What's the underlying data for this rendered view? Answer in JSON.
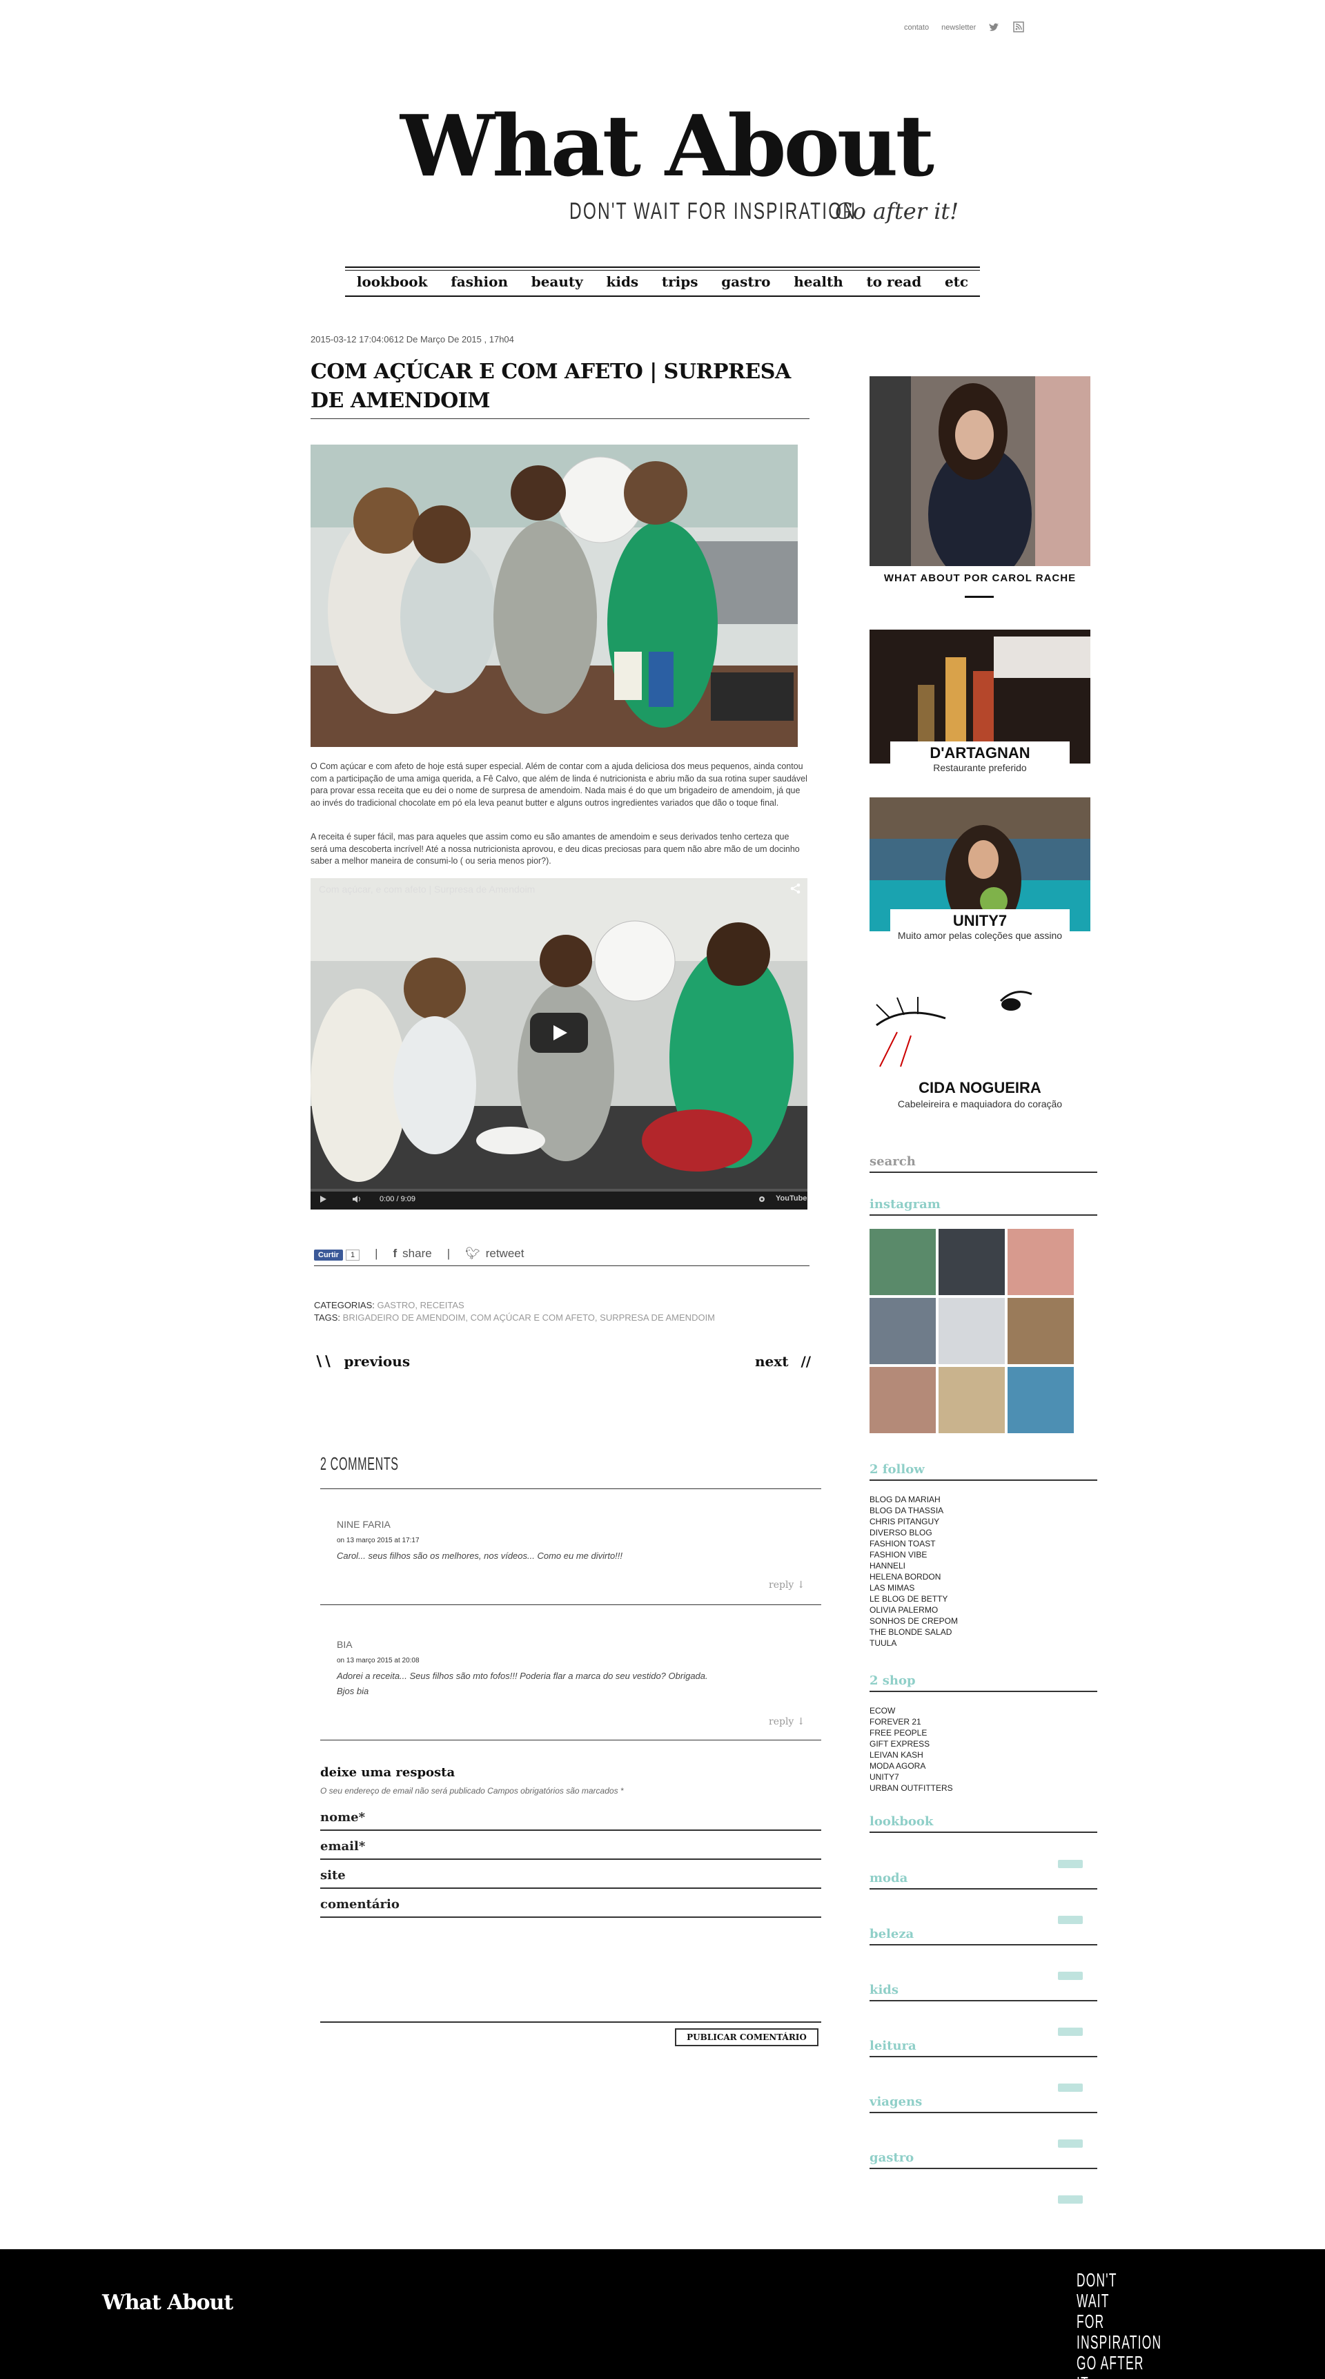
{
  "top_links": {
    "contato": "contato",
    "newsletter": "newsletter"
  },
  "site": {
    "logo": "What About",
    "tagline_left": "DON'T WAIT FOR INSPIRATION",
    "tagline_right": "Go after it!"
  },
  "nav": [
    "lookbook",
    "fashion",
    "beauty",
    "kids",
    "trips",
    "gastro",
    "health",
    "to read",
    "etc"
  ],
  "post": {
    "date": "2015-03-12 17:04:0612 De Março De 2015 , 17h04",
    "title": "COM AÇÚCAR E COM AFETO | SURPRESA DE AMENDOIM",
    "paragraph1": "O Com açúcar e com afeto de hoje está super especial. Além de contar com a ajuda deliciosa dos meus pequenos, ainda contou com a participação de uma amiga querida, a Fê Calvo, que além de linda é nutricionista e abriu mão da sua rotina super saudável para provar essa receita que eu dei o nome de surpresa de amendoim. Nada mais é do que um brigadeiro de amendoim, já que ao invés do tradicional chocolate em pó ela leva peanut butter e alguns outros ingredientes variados que dão o toque final.",
    "paragraph2": "A receita é super fácil, mas para aqueles que assim como eu são amantes de amendoim e seus derivados tenho certeza que será uma descoberta incrível! Até a nossa nutricionista aprovou, e deu dicas preciosas para quem não abre mão de um docinho saber a melhor maneira de consumi-lo ( ou seria menos pior?).",
    "video_title": "Com açúcar, e com afeto | Surpresa de Amendoim",
    "video_time": "0:00 / 9:09",
    "video_brand": "YouTube",
    "fb_label": "Curtir",
    "fb_count": "1",
    "share_label": "share",
    "retweet_label": "retweet",
    "categories_label": "CATEGORIAS:",
    "categories": "GASTRO, RECEITAS",
    "tags_label": "TAGS:",
    "tags": "BRIGADEIRO DE AMENDOIM, COM AÇÚCAR E COM AFETO, SURPRESA DE AMENDOIM",
    "prev_label": "previous",
    "next_label": "next"
  },
  "comments": {
    "heading": "2 COMMENTS",
    "items": [
      {
        "name": "NINE FARIA",
        "date": "on 13 março 2015 at 17:17",
        "body": "Carol... seus filhos são os melhores, nos vídeos... Como eu me divirto!!!",
        "reply": "reply ↓"
      },
      {
        "name": "BIA",
        "date": "on 13 março 2015 at 20:08",
        "body": "Adorei a receita... Seus filhos são mto fofos!!! Poderia flar a marca do seu vestido? Obrigada. Bjos bia",
        "reply": "reply ↓"
      }
    ]
  },
  "reply_form": {
    "heading": "deixe uma resposta",
    "note": "O seu endereço de email não será publicado Campos obrigatórios são marcados *",
    "name": "nome*",
    "email": "email*",
    "site": "site",
    "comment": "comentário",
    "submit": "PUBLICAR COMENTÁRIO"
  },
  "sidebar": {
    "ad1": "WHAT ABOUT POR CAROL RACHE",
    "ad2_title": "D'ARTAGNAN",
    "ad2_sub": "Restaurante preferido",
    "ad3_title": "UNITY7",
    "ad3_sub": "Muito amor pelas coleções que assino",
    "ad4_title": "CIDA NOGUEIRA",
    "ad4_sub": "Cabeleireira e maquiadora do coração",
    "search": "search",
    "instagram": "instagram",
    "follow_heading": "2 follow",
    "follow": [
      "BLOG DA MARIAH",
      "BLOG DA THASSIA",
      "CHRIS PITANGUY",
      "DIVERSO BLOG",
      "FASHION TOAST",
      "FASHION VIBE",
      "HANNELI",
      "HELENA BORDON",
      "LAS MIMAS",
      "LE BLOG DE BETTY",
      "OLIVIA PALERMO",
      "SONHOS DE CREPOM",
      "THE BLONDE SALAD",
      "TUULA"
    ],
    "shop_heading": "2 shop",
    "shop": [
      "ECOW",
      "FOREVER 21",
      "FREE PEOPLE",
      "GIFT EXPRESS",
      "LEIVAN KASH",
      "MODA AGORA",
      "UNITY7",
      "URBAN OUTFITTERS"
    ],
    "categories": [
      "lookbook",
      "moda",
      "beleza",
      "kids",
      "leitura",
      "viagens",
      "gastro"
    ]
  },
  "footer": {
    "logo": "What About",
    "tag_line1": "DON'T WAIT",
    "tag_line2": "FOR INSPIRATION",
    "tag_line3": "GO AFTER IT"
  }
}
